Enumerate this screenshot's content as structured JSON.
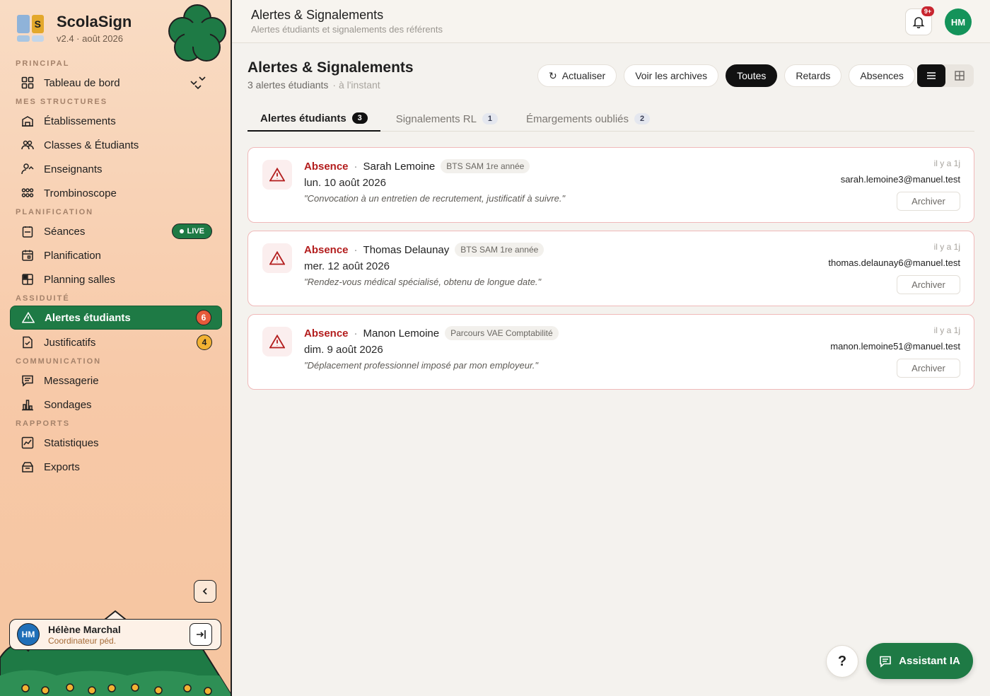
{
  "brand": {
    "name": "ScolaSign",
    "version": "v2.4 · août 2026",
    "logo_letter": "S"
  },
  "sidebar": {
    "sections": {
      "principal": "PRINCIPAL",
      "structures": "MES STRUCTURES",
      "planification": "PLANIFICATION",
      "assiduite": "ASSIDUITÉ",
      "communication": "COMMUNICATION",
      "rapports": "RAPPORTS"
    },
    "items": {
      "dashboard": "Tableau de bord",
      "etablissements": "Établissements",
      "classes": "Classes & Étudiants",
      "enseignants": "Enseignants",
      "trombinoscope": "Trombinoscope",
      "seances": "Séances",
      "planification": "Planification",
      "planning_salles": "Planning salles",
      "alertes": "Alertes étudiants",
      "justificatifs": "Justificatifs",
      "messagerie": "Messagerie",
      "sondages": "Sondages",
      "statistiques": "Statistiques",
      "exports": "Exports"
    },
    "badges": {
      "live": "LIVE",
      "alertes": "6",
      "justificatifs": "4"
    },
    "user": {
      "initials": "HM",
      "name": "Hélène Marchal",
      "role": "Coordinateur péd."
    }
  },
  "topbar": {
    "title": "Alertes & Signalements",
    "subtitle": "Alertes étudiants et signalements des référents",
    "notif_badge": "9+",
    "avatar": "HM"
  },
  "main": {
    "title": "Alertes & Signalements",
    "count_text": "3 alertes étudiants",
    "updated": "· à l'instant",
    "filters": {
      "refresh": "Actualiser",
      "archives": "Voir les archives",
      "all": "Toutes",
      "late": "Retards",
      "absences": "Absences"
    },
    "tabs": [
      {
        "label": "Alertes étudiants",
        "count": "3"
      },
      {
        "label": "Signalements RL",
        "count": "1"
      },
      {
        "label": "Émargements oubliés",
        "count": "2"
      }
    ],
    "alerts": [
      {
        "type": "Absence",
        "student": "Sarah Lemoine",
        "class": "BTS SAM 1re année",
        "date": "lun. 10 août 2026",
        "reason": "\"Convocation à un entretien de recrutement, justificatif à suivre.\"",
        "time": "il y a 1j",
        "email": "sarah.lemoine3@manuel.test",
        "action": "Archiver"
      },
      {
        "type": "Absence",
        "student": "Thomas Delaunay",
        "class": "BTS SAM 1re année",
        "date": "mer. 12 août 2026",
        "reason": "\"Rendez-vous médical spécialisé, obtenu de longue date.\"",
        "time": "il y a 1j",
        "email": "thomas.delaunay6@manuel.test",
        "action": "Archiver"
      },
      {
        "type": "Absence",
        "student": "Manon Lemoine",
        "class": "Parcours VAE Comptabilité",
        "date": "dim. 9 août 2026",
        "reason": "\"Déplacement professionnel imposé par mon employeur.\"",
        "time": "il y a 1j",
        "email": "manon.lemoine51@manuel.test",
        "action": "Archiver"
      }
    ]
  },
  "floating": {
    "help": "?",
    "assistant": "Assistant IA"
  },
  "colors": {
    "accent_green": "#1e7a45",
    "alert_red": "#b31d1d",
    "card_border": "#f0b9b9"
  }
}
